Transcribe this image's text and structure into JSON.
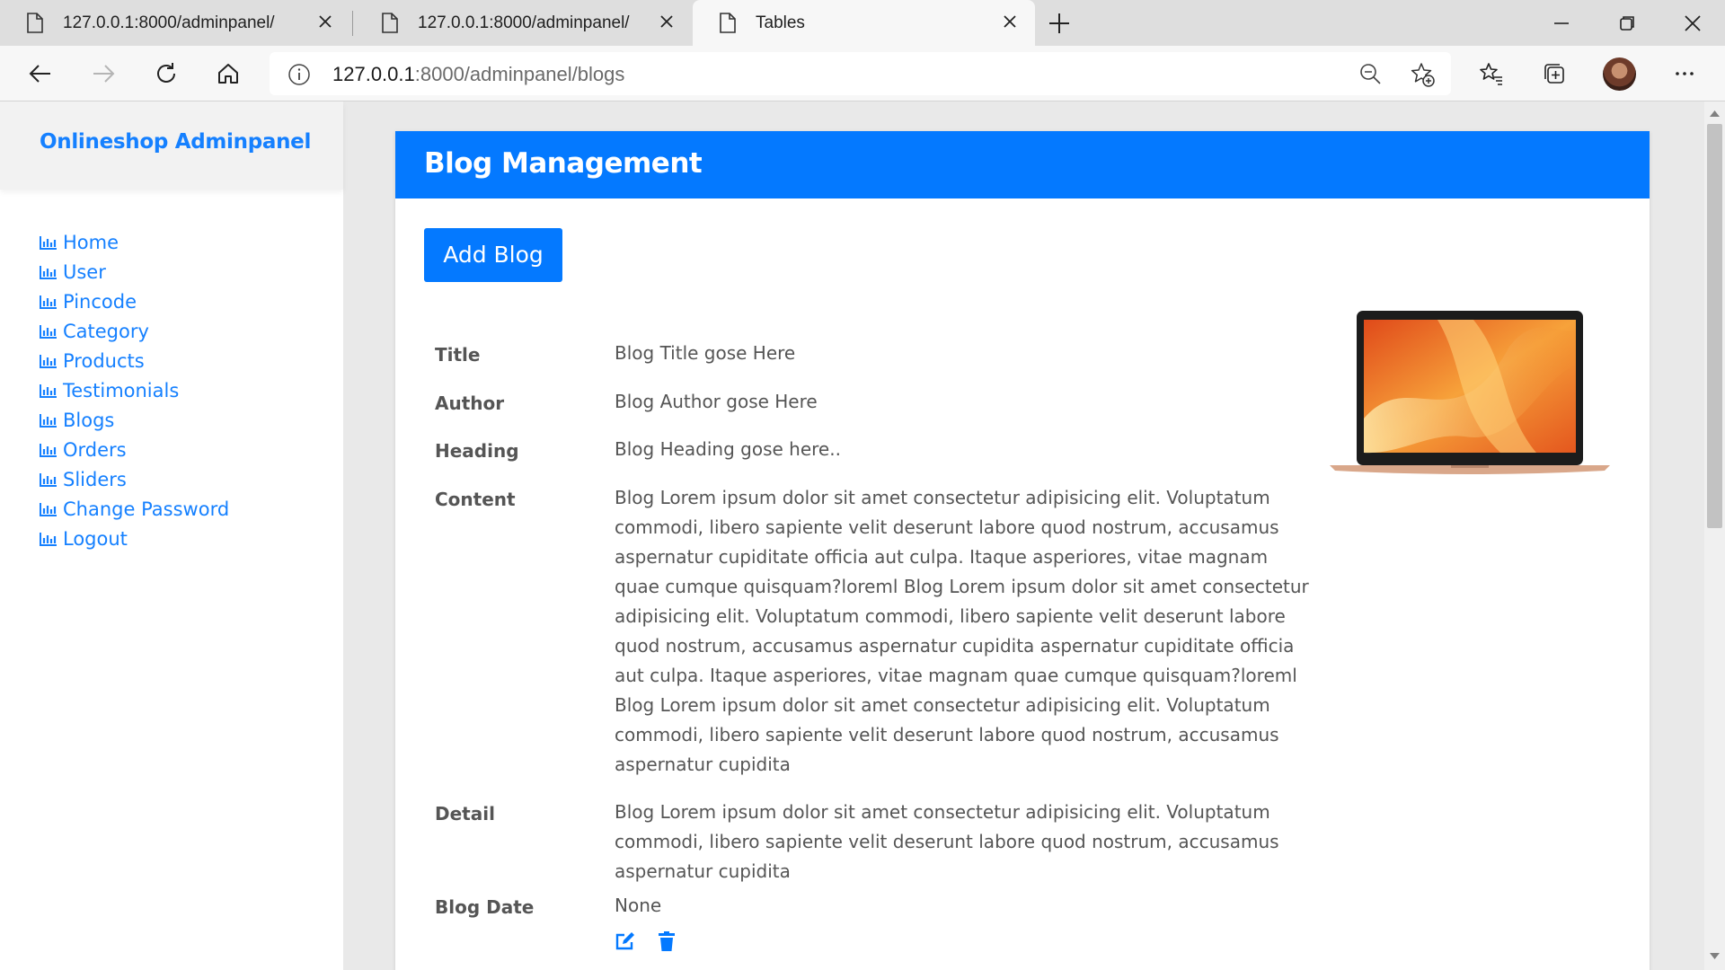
{
  "browser": {
    "tabs": [
      {
        "title": "127.0.0.1:8000/adminpanel/",
        "active": false
      },
      {
        "title": "127.0.0.1:8000/adminpanel/",
        "active": false
      },
      {
        "title": "Tables",
        "active": true
      }
    ],
    "url_host": "127.0.0.1",
    "url_rest": ":8000/adminpanel/blogs",
    "icons": [
      "page-icon",
      "close-icon",
      "plus-icon",
      "minimize-icon",
      "restore-icon",
      "back-icon",
      "forward-icon",
      "refresh-icon",
      "home-icon",
      "info-icon",
      "zoom-out-icon",
      "add-favorite-icon",
      "favorites-icon",
      "collections-icon",
      "avatar",
      "more-icon"
    ]
  },
  "sidebar": {
    "brand": "Onlineshop Adminpanel",
    "items": [
      {
        "label": "Home",
        "icon": "bar-chart-icon"
      },
      {
        "label": "User",
        "icon": "bar-chart-icon"
      },
      {
        "label": "Pincode",
        "icon": "bar-chart-icon"
      },
      {
        "label": "Category",
        "icon": "bar-chart-icon"
      },
      {
        "label": "Products",
        "icon": "bar-chart-icon"
      },
      {
        "label": "Testimonials",
        "icon": "bar-chart-icon"
      },
      {
        "label": "Blogs",
        "icon": "bar-chart-icon"
      },
      {
        "label": "Orders",
        "icon": "bar-chart-icon"
      },
      {
        "label": "Sliders",
        "icon": "bar-chart-icon"
      },
      {
        "label": "Change Password",
        "icon": "bar-chart-icon"
      },
      {
        "label": "Logout",
        "icon": "bar-chart-icon"
      }
    ]
  },
  "main": {
    "title": "Blog Management",
    "add_button": "Add Blog",
    "labels": {
      "title": "Title",
      "author": "Author",
      "heading": "Heading",
      "content": "Content",
      "detail": "Detail",
      "blog_date": "Blog Date"
    },
    "values": {
      "title": "Blog Title gose Here",
      "author": "Blog Author gose Here",
      "heading": "Blog Heading gose here..",
      "content": "Blog Lorem ipsum dolor sit amet consectetur adipisicing elit. Voluptatum commodi, libero sapiente velit deserunt labore quod nostrum, accusamus aspernatur cupiditate officia aut culpa. Itaque asperiores, vitae magnam quae cumque quisquam?loreml Blog Lorem ipsum dolor sit amet consectetur adipisicing elit. Voluptatum commodi, libero sapiente velit deserunt labore quod nostrum, accusamus aspernatur cupidita aspernatur cupiditate officia aut culpa. Itaque asperiores, vitae magnam quae cumque quisquam?loreml Blog Lorem ipsum dolor sit amet consectetur adipisicing elit. Voluptatum commodi, libero sapiente velit deserunt labore quod nostrum, accusamus aspernatur cupidita",
      "detail": "Blog Lorem ipsum dolor sit amet consectetur adipisicing elit. Voluptatum commodi, libero sapiente velit deserunt labore quod nostrum, accusamus aspernatur cupidita",
      "blog_date": "None"
    },
    "action_icons": [
      "edit-icon",
      "trash-icon"
    ]
  },
  "colors": {
    "accent": "#0479ff",
    "link": "#1580ff",
    "text": "#555555"
  }
}
